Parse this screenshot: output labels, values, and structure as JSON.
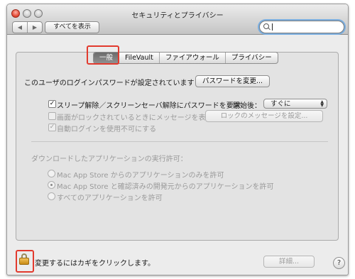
{
  "window": {
    "title": "セキュリティとプライバシー"
  },
  "toolbar": {
    "back_glyph": "◀",
    "forward_glyph": "▶",
    "show_all_label": "すべてを表示",
    "search_value": ""
  },
  "tabs": [
    {
      "label": "一般",
      "active": true
    },
    {
      "label": "FileVault",
      "active": false
    },
    {
      "label": "ファイアウォール",
      "active": false
    },
    {
      "label": "プライバシー",
      "active": false
    }
  ],
  "general": {
    "login_password_text": "このユーザのログインパスワードが設定されています",
    "change_password_button": "パスワードを変更...",
    "require_password": {
      "label": "スリープ解除／スクリーンセーバ解除にパスワードを要求",
      "checked": true,
      "check_glyph": "✓"
    },
    "start_label": "開始後：",
    "start_select_value": "すぐに",
    "show_message": {
      "label": "画面がロックされているときにメッセージを表示",
      "checked": false,
      "enabled": false
    },
    "lock_message_button": "ロックのメッセージを設定...",
    "disable_auto_login": {
      "label": "自動ログインを使用不可にする",
      "checked": true,
      "enabled": false,
      "check_glyph": "✓"
    }
  },
  "downloads": {
    "heading": "ダウンロードしたアプリケーションの実行許可：",
    "options": [
      {
        "label": "Mac App Store からのアプリケーションのみを許可",
        "selected": false
      },
      {
        "label": "Mac App Store と確認済みの開発元からのアプリケーションを許可",
        "selected": true
      },
      {
        "label": "すべてのアプリケーションを許可",
        "selected": false
      }
    ]
  },
  "footer": {
    "lock_text": "変更するにはカギをクリックします。",
    "advanced_button": "詳細...",
    "help_glyph": "?"
  },
  "colors": {
    "highlight": "#e23a2e",
    "search_focus": "#7aaee0"
  }
}
